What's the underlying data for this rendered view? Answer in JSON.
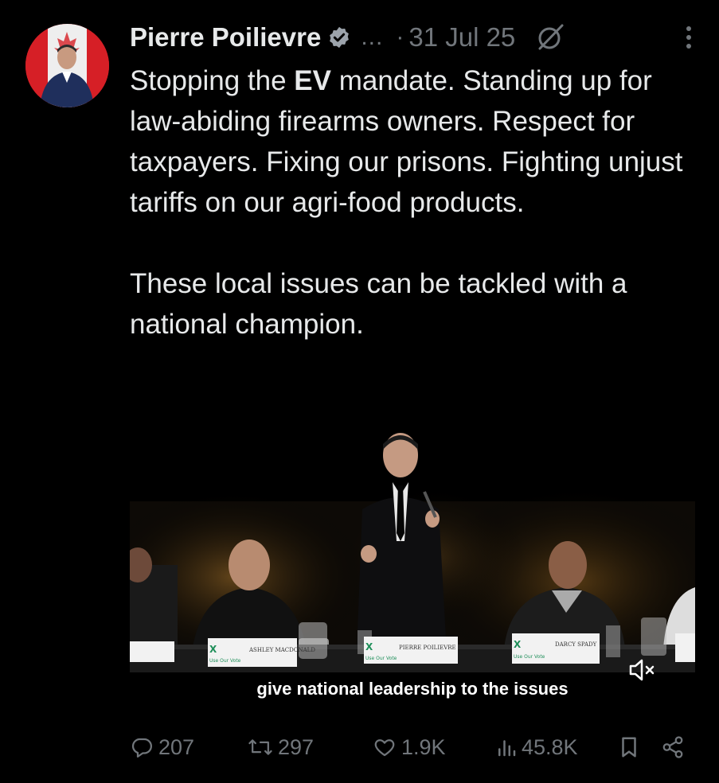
{
  "post": {
    "author_name": "Pierre Poilievre",
    "truncation": "...",
    "separator": "·",
    "date": "31 Jul 25",
    "paragraphs": [
      [
        "Stopping the ",
        "EV",
        " mandate. Standing up for law-abiding firearms owners. Respect for taxpayers. Fixing our prisons. Fighting unjust tariffs on our agri-food products."
      ],
      "These local issues can be tackled with a national champion."
    ]
  },
  "media": {
    "caption": "give national leadership to the issues",
    "placards": [
      "ASHLEY MACDONALD",
      "PIERRE POILIEVRE",
      "DARCY SPADY"
    ],
    "logo_text": "Use Our Vote"
  },
  "actions": {
    "replies": "207",
    "reposts": "297",
    "likes": "1.9K",
    "views": "45.8K"
  },
  "icons": [
    "avatar",
    "verified-badge-icon",
    "grok-icon",
    "more-icon",
    "mute-icon",
    "reply-icon",
    "repost-icon",
    "like-icon",
    "views-icon",
    "bookmark-icon",
    "share-icon"
  ],
  "colors": {
    "background": "#000000",
    "text": "#e7e9ea",
    "muted": "#71767b",
    "verified": "#1d9bf0"
  }
}
